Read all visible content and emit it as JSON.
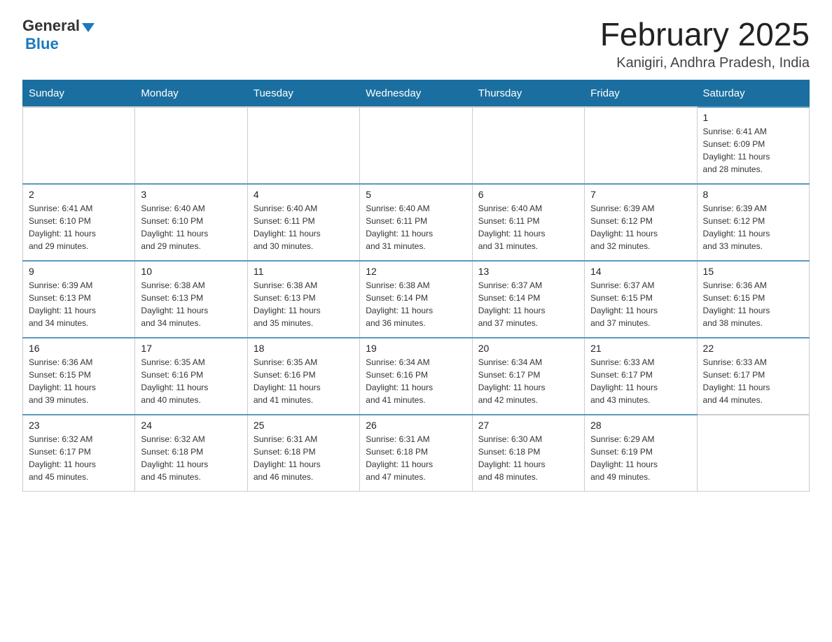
{
  "logo": {
    "general": "General",
    "blue": "Blue"
  },
  "title": "February 2025",
  "location": "Kanigiri, Andhra Pradesh, India",
  "days_of_week": [
    "Sunday",
    "Monday",
    "Tuesday",
    "Wednesday",
    "Thursday",
    "Friday",
    "Saturday"
  ],
  "weeks": [
    [
      {
        "day": "",
        "info": ""
      },
      {
        "day": "",
        "info": ""
      },
      {
        "day": "",
        "info": ""
      },
      {
        "day": "",
        "info": ""
      },
      {
        "day": "",
        "info": ""
      },
      {
        "day": "",
        "info": ""
      },
      {
        "day": "1",
        "info": "Sunrise: 6:41 AM\nSunset: 6:09 PM\nDaylight: 11 hours\nand 28 minutes."
      }
    ],
    [
      {
        "day": "2",
        "info": "Sunrise: 6:41 AM\nSunset: 6:10 PM\nDaylight: 11 hours\nand 29 minutes."
      },
      {
        "day": "3",
        "info": "Sunrise: 6:40 AM\nSunset: 6:10 PM\nDaylight: 11 hours\nand 29 minutes."
      },
      {
        "day": "4",
        "info": "Sunrise: 6:40 AM\nSunset: 6:11 PM\nDaylight: 11 hours\nand 30 minutes."
      },
      {
        "day": "5",
        "info": "Sunrise: 6:40 AM\nSunset: 6:11 PM\nDaylight: 11 hours\nand 31 minutes."
      },
      {
        "day": "6",
        "info": "Sunrise: 6:40 AM\nSunset: 6:11 PM\nDaylight: 11 hours\nand 31 minutes."
      },
      {
        "day": "7",
        "info": "Sunrise: 6:39 AM\nSunset: 6:12 PM\nDaylight: 11 hours\nand 32 minutes."
      },
      {
        "day": "8",
        "info": "Sunrise: 6:39 AM\nSunset: 6:12 PM\nDaylight: 11 hours\nand 33 minutes."
      }
    ],
    [
      {
        "day": "9",
        "info": "Sunrise: 6:39 AM\nSunset: 6:13 PM\nDaylight: 11 hours\nand 34 minutes."
      },
      {
        "day": "10",
        "info": "Sunrise: 6:38 AM\nSunset: 6:13 PM\nDaylight: 11 hours\nand 34 minutes."
      },
      {
        "day": "11",
        "info": "Sunrise: 6:38 AM\nSunset: 6:13 PM\nDaylight: 11 hours\nand 35 minutes."
      },
      {
        "day": "12",
        "info": "Sunrise: 6:38 AM\nSunset: 6:14 PM\nDaylight: 11 hours\nand 36 minutes."
      },
      {
        "day": "13",
        "info": "Sunrise: 6:37 AM\nSunset: 6:14 PM\nDaylight: 11 hours\nand 37 minutes."
      },
      {
        "day": "14",
        "info": "Sunrise: 6:37 AM\nSunset: 6:15 PM\nDaylight: 11 hours\nand 37 minutes."
      },
      {
        "day": "15",
        "info": "Sunrise: 6:36 AM\nSunset: 6:15 PM\nDaylight: 11 hours\nand 38 minutes."
      }
    ],
    [
      {
        "day": "16",
        "info": "Sunrise: 6:36 AM\nSunset: 6:15 PM\nDaylight: 11 hours\nand 39 minutes."
      },
      {
        "day": "17",
        "info": "Sunrise: 6:35 AM\nSunset: 6:16 PM\nDaylight: 11 hours\nand 40 minutes."
      },
      {
        "day": "18",
        "info": "Sunrise: 6:35 AM\nSunset: 6:16 PM\nDaylight: 11 hours\nand 41 minutes."
      },
      {
        "day": "19",
        "info": "Sunrise: 6:34 AM\nSunset: 6:16 PM\nDaylight: 11 hours\nand 41 minutes."
      },
      {
        "day": "20",
        "info": "Sunrise: 6:34 AM\nSunset: 6:17 PM\nDaylight: 11 hours\nand 42 minutes."
      },
      {
        "day": "21",
        "info": "Sunrise: 6:33 AM\nSunset: 6:17 PM\nDaylight: 11 hours\nand 43 minutes."
      },
      {
        "day": "22",
        "info": "Sunrise: 6:33 AM\nSunset: 6:17 PM\nDaylight: 11 hours\nand 44 minutes."
      }
    ],
    [
      {
        "day": "23",
        "info": "Sunrise: 6:32 AM\nSunset: 6:17 PM\nDaylight: 11 hours\nand 45 minutes."
      },
      {
        "day": "24",
        "info": "Sunrise: 6:32 AM\nSunset: 6:18 PM\nDaylight: 11 hours\nand 45 minutes."
      },
      {
        "day": "25",
        "info": "Sunrise: 6:31 AM\nSunset: 6:18 PM\nDaylight: 11 hours\nand 46 minutes."
      },
      {
        "day": "26",
        "info": "Sunrise: 6:31 AM\nSunset: 6:18 PM\nDaylight: 11 hours\nand 47 minutes."
      },
      {
        "day": "27",
        "info": "Sunrise: 6:30 AM\nSunset: 6:18 PM\nDaylight: 11 hours\nand 48 minutes."
      },
      {
        "day": "28",
        "info": "Sunrise: 6:29 AM\nSunset: 6:19 PM\nDaylight: 11 hours\nand 49 minutes."
      },
      {
        "day": "",
        "info": ""
      }
    ]
  ]
}
